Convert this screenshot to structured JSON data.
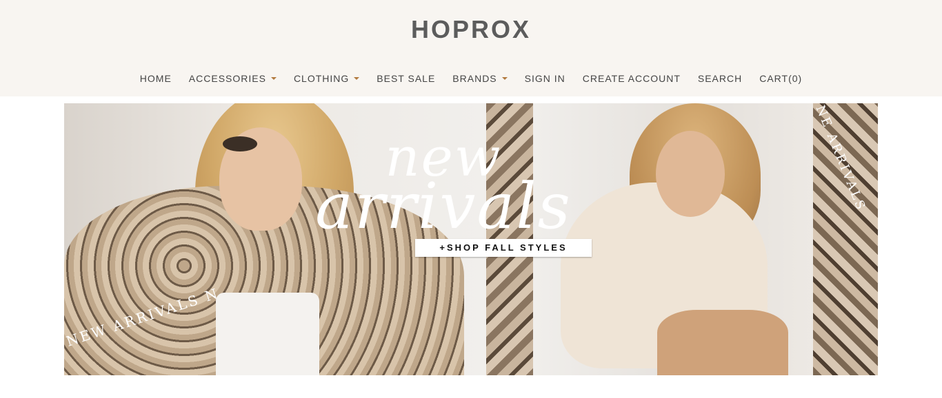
{
  "site": {
    "logo": "HOPROX"
  },
  "nav": {
    "home": "HOME",
    "accessories": "ACCESSORIES",
    "clothing": "CLOTHING",
    "best_sale": "BEST SALE",
    "brands": "BRANDS",
    "sign_in": "SIGN IN",
    "create_account": "CREATE ACCOUNT",
    "search": "SEARCH",
    "cart": "CART(0)"
  },
  "banner": {
    "title_line1": "new",
    "title_line2": "arrivals",
    "cta": "+SHOP FALL STYLES",
    "curved_text_left": "NEW ARRIVALS N",
    "curved_text_right": "NE ARRIVALS"
  },
  "colors": {
    "header_bg": "#f8f5f1",
    "logo": "#5c5c5c",
    "nav_text": "#444444",
    "caret": "#b27a3f"
  }
}
